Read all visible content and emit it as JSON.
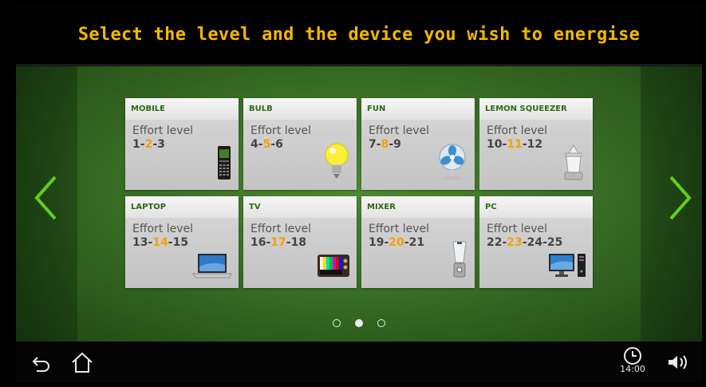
{
  "header": {
    "title": "Select the level and the device you wish to energise"
  },
  "devices": [
    {
      "name": "MOBILE",
      "effort_label": "Effort level",
      "levels": [
        "1",
        "2",
        "3"
      ],
      "highlight": 1,
      "icon": "mobile-phone-icon"
    },
    {
      "name": "BULB",
      "effort_label": "Effort level",
      "levels": [
        "4",
        "5",
        "6"
      ],
      "highlight": 1,
      "icon": "light-bulb-icon"
    },
    {
      "name": "FUN",
      "effort_label": "Effort level",
      "levels": [
        "7",
        "8",
        "9"
      ],
      "highlight": 1,
      "icon": "fan-icon"
    },
    {
      "name": "LEMON SQUEEZER",
      "effort_label": "Effort level",
      "levels": [
        "10",
        "11",
        "12"
      ],
      "highlight": 1,
      "icon": "lemon-squeezer-icon"
    },
    {
      "name": "LAPTOP",
      "effort_label": "Effort level",
      "levels": [
        "13",
        "14",
        "15"
      ],
      "highlight": 1,
      "icon": "laptop-icon"
    },
    {
      "name": "TV",
      "effort_label": "Effort level",
      "levels": [
        "16",
        "17",
        "18"
      ],
      "highlight": 1,
      "icon": "tv-icon"
    },
    {
      "name": "MIXER",
      "effort_label": "Effort level",
      "levels": [
        "19",
        "20",
        "21"
      ],
      "highlight": 1,
      "icon": "mixer-icon"
    },
    {
      "name": "PC",
      "effort_label": "Effort level",
      "levels": [
        "22",
        "23",
        "24",
        "25"
      ],
      "highlight": 1,
      "icon": "pc-icon"
    }
  ],
  "pagination": {
    "pages": 3,
    "active": 1
  },
  "navbar": {
    "clock": "14:00"
  },
  "colors": {
    "title": "#f5b800",
    "highlight": "#f5a000",
    "card_title": "#2d6a14",
    "arrow": "#5fcf1e"
  }
}
